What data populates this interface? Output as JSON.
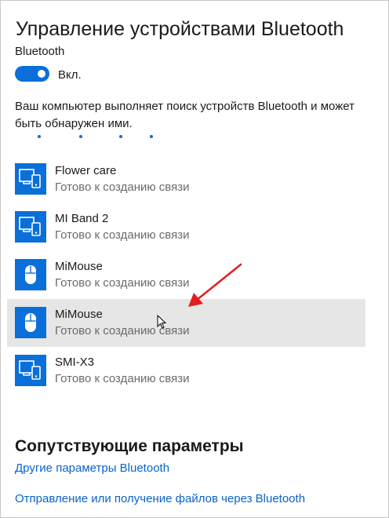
{
  "header": {
    "title": "Управление устройствами Bluetooth"
  },
  "bluetooth": {
    "label": "Bluetooth",
    "toggle_state": "Вкл.",
    "toggle_on": true,
    "status_text": "Ваш компьютер выполняет поиск устройств Bluetooth и может быть обнаружен ими."
  },
  "devices": [
    {
      "name": "Flower care",
      "status": "Готово к созданию связи",
      "icon": "computer-device-icon",
      "selected": false
    },
    {
      "name": "MI Band 2",
      "status": "Готово к созданию связи",
      "icon": "computer-device-icon",
      "selected": false
    },
    {
      "name": "MiMouse",
      "status": "Готово к созданию связи",
      "icon": "mouse-icon",
      "selected": false
    },
    {
      "name": "MiMouse",
      "status": "Готово к созданию связи",
      "icon": "mouse-icon",
      "selected": true
    },
    {
      "name": "SMI-X3",
      "status": "Готово к созданию связи",
      "icon": "computer-device-icon",
      "selected": false
    }
  ],
  "related": {
    "title": "Сопутствующие параметры",
    "links": [
      "Другие параметры Bluetooth",
      "Отправление или получение файлов через Bluetooth"
    ]
  },
  "colors": {
    "accent": "#0a6fd8",
    "link": "#0a63c9",
    "selected_row": "#e6e6e6",
    "annotation_arrow": "#e02020"
  }
}
